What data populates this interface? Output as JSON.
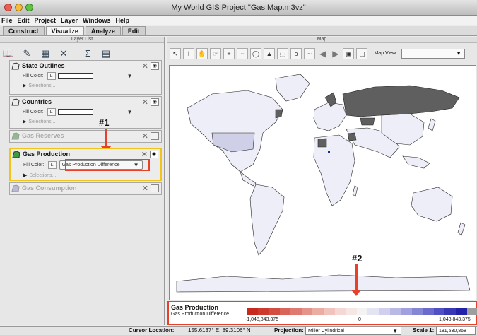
{
  "window": {
    "title": "My World GIS Project \"Gas Map.m3vz\"",
    "traffic_lights": [
      "#ed5d53",
      "#f4bc3a",
      "#5fc443"
    ]
  },
  "menubar": [
    "File",
    "Edit",
    "Project",
    "Layer",
    "Windows",
    "Help"
  ],
  "tabs": [
    {
      "label": "Construct",
      "active": false
    },
    {
      "label": "Visualize",
      "active": true
    },
    {
      "label": "Analyze",
      "active": false
    },
    {
      "label": "Edit",
      "active": false
    }
  ],
  "layer_list": {
    "header": "Layer List",
    "toolbar_icons": [
      "book-icon",
      "edit-layer-icon",
      "table-icon",
      "delete-icon",
      "sum-icon",
      "chart-icon"
    ],
    "layers": [
      {
        "name": "State Outlines",
        "fill_label": "Fill Color:",
        "selections": "Selections..."
      },
      {
        "name": "Countries",
        "fill_label": "Fill Color:",
        "selections": "Selections..."
      },
      {
        "name": "Gas Reserves",
        "dimmed": true
      },
      {
        "name": "Gas Production",
        "fill_label": "Fill Color:",
        "fill_value": "Gas Production Difference",
        "selections": "Selections...",
        "highlighted": true
      },
      {
        "name": "Gas Consumption",
        "dimmed": true
      }
    ]
  },
  "annotations": {
    "one": "#1",
    "two": "#2",
    "accent": "#e8412a",
    "highlight": "#f0c419"
  },
  "map": {
    "header": "Map",
    "map_view_label": "Map View:",
    "map_view_value": ""
  },
  "legend": {
    "title": "Gas Production",
    "subtitle": "Gas Production Difference",
    "min_label": "-1,048,843.375",
    "mid_label": "0",
    "max_label": "1,048,843.375",
    "ramp_colors": [
      "#c8291e",
      "#cc3a2d",
      "#d34d41",
      "#d96459",
      "#df7a70",
      "#e59388",
      "#ebaca2",
      "#f0c4bd",
      "#f4d8d3",
      "#f7e7e4",
      "#f3f3f3",
      "#e4e4f3",
      "#d0d0ee",
      "#b9b9e6",
      "#a0a0df",
      "#8585d6",
      "#6a6acd",
      "#5050c3",
      "#3838b7",
      "#2121aa",
      "#9e9e9e"
    ]
  },
  "status": {
    "cursor_label": "Cursor Location:",
    "cursor_value": "155.6137° E, 89.3106° N",
    "projection_label": "Projection:",
    "projection_value": "Miller Cylindrical",
    "scale_label": "Scale 1:",
    "scale_value": "181,530,868"
  }
}
